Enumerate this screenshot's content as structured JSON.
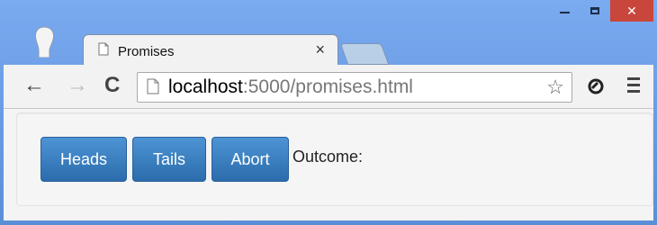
{
  "browser": {
    "tab": {
      "title": "Promises",
      "close_glyph": "×",
      "icon": "page-icon"
    },
    "window_controls": {
      "minimize": "minimize-icon",
      "maximize": "maximize-icon",
      "close_glyph": "✕"
    },
    "toolbar": {
      "back_glyph": "←",
      "forward_glyph": "→",
      "reload_glyph": "C",
      "url_host": "localhost",
      "url_rest": ":5000/promises.html",
      "star_glyph": "☆"
    }
  },
  "page": {
    "buttons": {
      "heads": "Heads",
      "tails": "Tails",
      "abort": "Abort"
    },
    "outcome_label": "Outcome:"
  },
  "colors": {
    "button_primary": "#337ab7",
    "close_button": "#c9463d"
  }
}
